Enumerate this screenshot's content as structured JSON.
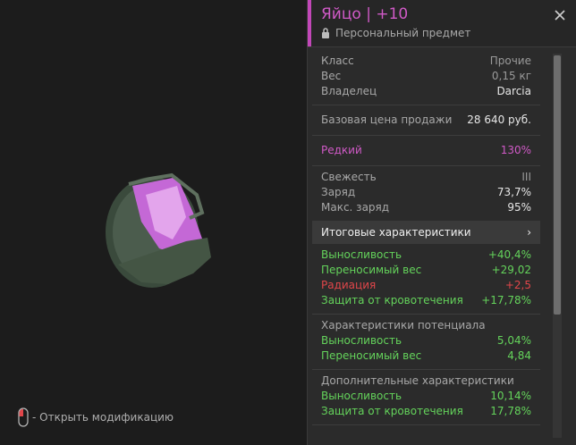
{
  "item": {
    "title": "Яйцо | +10",
    "subtitle": "Персональный предмет"
  },
  "hint": {
    "label": "- Открыть модификацию"
  },
  "info": {
    "class_label": "Класс",
    "class_value": "Прочие",
    "weight_label": "Вес",
    "weight_value": "0,15 кг",
    "owner_label": "Владелец",
    "owner_value": "Darcia"
  },
  "price": {
    "label": "Базовая цена продажи",
    "value": "28 640 руб."
  },
  "rarity": {
    "label": "Редкий",
    "value": "130%"
  },
  "state": {
    "freshness_label": "Свежесть",
    "freshness_value": "III",
    "charge_label": "Заряд",
    "charge_value": "73,7%",
    "max_charge_label": "Макс. заряд",
    "max_charge_value": "95%"
  },
  "totals": {
    "nav_label": "Итоговые характеристики",
    "rows": [
      {
        "label": "Выносливость",
        "value": "+40,4%"
      },
      {
        "label": "Переносимый вес",
        "value": "+29,02"
      },
      {
        "label": "Радиация",
        "value": "+2,5"
      },
      {
        "label": "Защита от кровотечения",
        "value": "+17,78%"
      }
    ]
  },
  "potential": {
    "heading": "Характеристики потенциала",
    "rows": [
      {
        "label": "Выносливость",
        "value": "5,04%"
      },
      {
        "label": "Переносимый вес",
        "value": "4,84"
      }
    ]
  },
  "extra": {
    "heading": "Дополнительные характеристики",
    "rows": [
      {
        "label": "Выносливость",
        "value": "10,14%"
      },
      {
        "label": "Защита от кровотечения",
        "value": "17,78%"
      }
    ]
  },
  "colors": {
    "accent": "#c247b8",
    "positive": "#64d35b",
    "negative": "#e0464a",
    "rarity": "#d05ac7"
  }
}
